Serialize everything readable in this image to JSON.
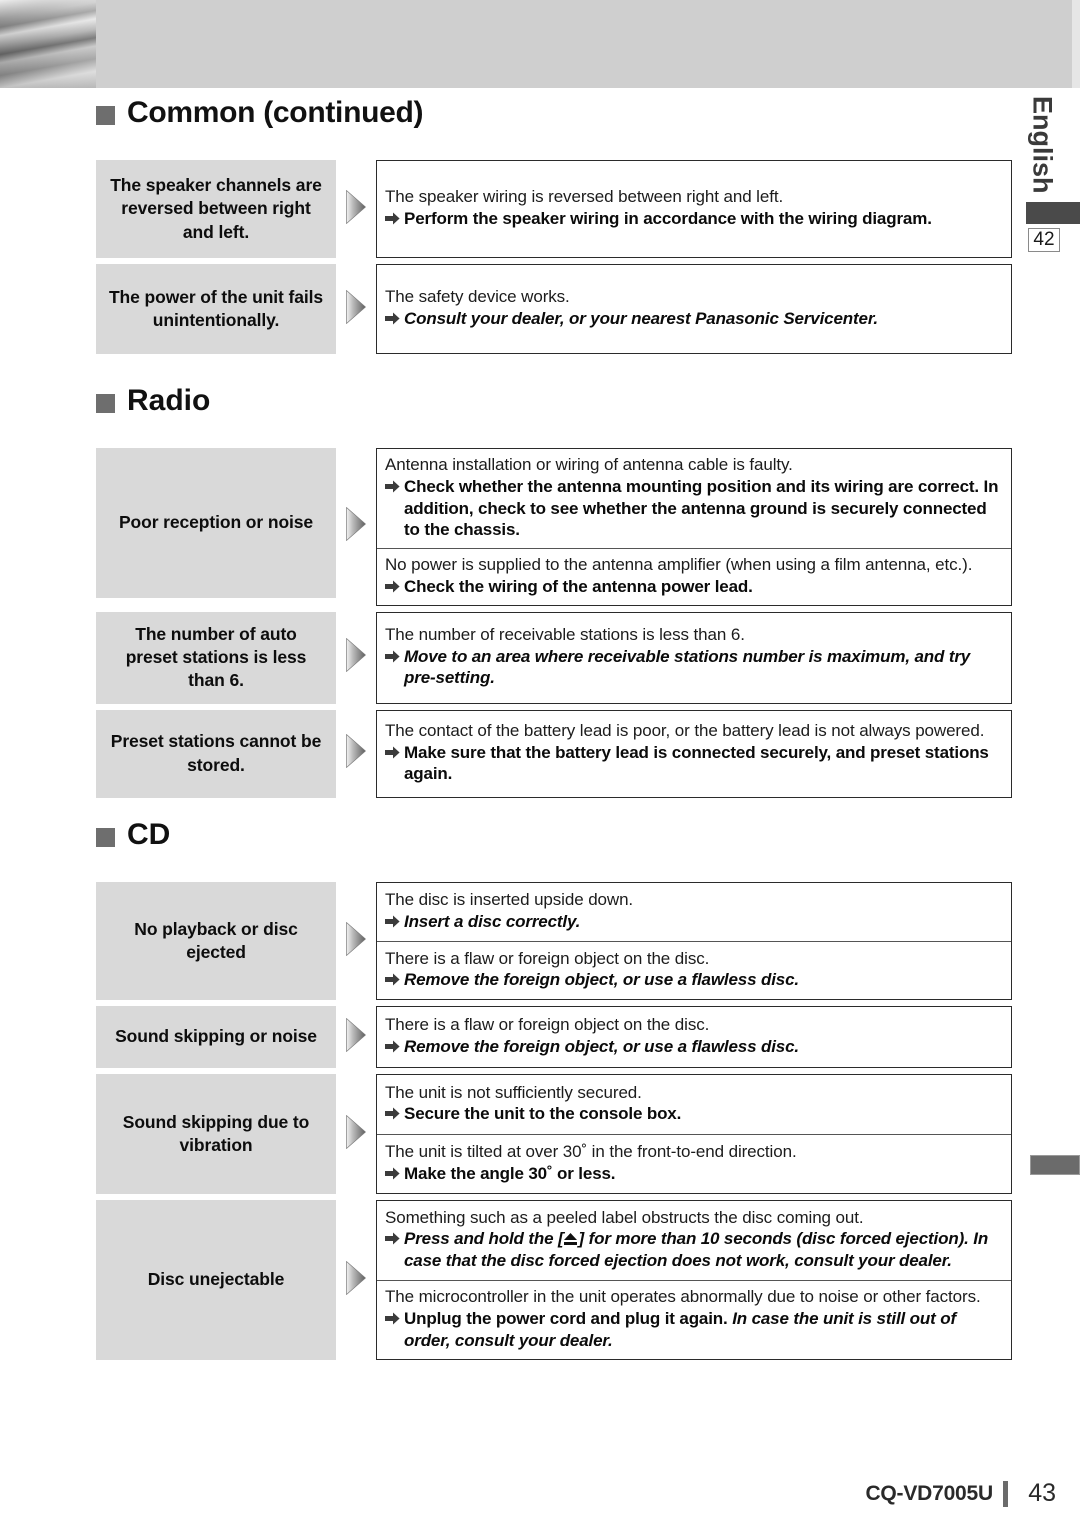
{
  "side_tab": {
    "language_label": "English",
    "page_reference": "42"
  },
  "footer": {
    "model": "CQ-VD7005U",
    "page_number": "43"
  },
  "sections": [
    {
      "heading": "Common (continued)",
      "rows": [
        {
          "symptom": "The speaker channels are reversed between right and left.",
          "label_height": 98,
          "answers": [
            {
              "cause": "The speaker wiring is reversed between right and left.",
              "fix": "Perform the speaker wiring in accordance with the wiring diagram.",
              "fix_style": "bold"
            }
          ]
        },
        {
          "symptom": "The power of the unit fails unintentionally.",
          "label_height": 90,
          "answers": [
            {
              "cause": "The safety device works.",
              "fix": "Consult your dealer, or your nearest Panasonic Servicenter.",
              "fix_style": "bold-italic"
            }
          ]
        }
      ]
    },
    {
      "heading": "Radio",
      "rows": [
        {
          "symptom": "Poor reception or noise",
          "label_height": 150,
          "answers": [
            {
              "cause": "Antenna installation or wiring of antenna cable is faulty.",
              "fix": "Check whether the antenna mounting position and its wiring are correct. In addition, check to see whether the antenna ground is securely connected to the chassis.",
              "fix_style": "bold"
            },
            {
              "cause": "No power is supplied to the antenna amplifier (when using a film antenna, etc.).",
              "fix": "Check the wiring of the antenna power lead.",
              "fix_style": "bold"
            }
          ]
        },
        {
          "symptom": "The number of auto preset stations is less than 6.",
          "label_height": 92,
          "answers": [
            {
              "cause": "The number of receivable stations is less than 6.",
              "fix": "Move to an area where receivable stations number is maximum, and try pre-setting.",
              "fix_style": "bold-italic"
            }
          ]
        },
        {
          "symptom": "Preset stations cannot be stored.",
          "label_height": 88,
          "answers": [
            {
              "cause": "The contact of the battery lead is poor, or the battery lead is not always powered.",
              "fix": "Make sure that the battery lead is connected securely, and preset stations again.",
              "fix_style": "bold"
            }
          ]
        }
      ]
    },
    {
      "heading": "CD",
      "rows": [
        {
          "symptom": "No playback or disc ejected",
          "label_height": 118,
          "answers": [
            {
              "cause": "The disc is inserted upside down.",
              "fix": "Insert a disc correctly.",
              "fix_style": "bold-italic"
            },
            {
              "cause": "There is a flaw or foreign object on the disc.",
              "fix": "Remove the foreign object, or use a flawless disc.",
              "fix_style": "bold-italic"
            }
          ]
        },
        {
          "symptom": "Sound skipping or noise",
          "label_height": 62,
          "answers": [
            {
              "cause": "There is a flaw or foreign object on the disc.",
              "fix": "Remove the foreign object, or use a flawless disc.",
              "fix_style": "bold-italic"
            }
          ]
        },
        {
          "symptom": "Sound skipping due to vibration",
          "label_height": 120,
          "answers": [
            {
              "cause": "The unit is not sufficiently secured.",
              "fix": "Secure the unit to the console box.",
              "fix_style": "bold"
            },
            {
              "cause": "The unit is tilted at over 30˚ in the front-to-end direction.",
              "fix": "Make the angle 30˚ or less.",
              "fix_style": "bold"
            }
          ]
        },
        {
          "symptom": "Disc unejectable",
          "label_height": 160,
          "answers": [
            {
              "cause": "Something such as a peeled label obstructs the disc coming out.",
              "fix": "Press and hold the [⏏] for more than 10 seconds (disc forced ejection). In case that the disc forced ejection does not work, consult your dealer.",
              "fix_style": "bold-italic",
              "has_eject_icon": true
            },
            {
              "cause": "The microcontroller in the unit operates abnormally due to noise or other factors.",
              "fix_lead": "Unplug the power cord and plug it again.",
              "fix_tail": "In case the unit is still out of order, consult your dealer.",
              "fix_style": "mixed"
            }
          ]
        }
      ]
    }
  ],
  "colors": {
    "label_bg": "#d9d9d9",
    "head_square": "#6e6e6e",
    "side_bar": "#4a4a4a",
    "border": "#2b2b2b"
  }
}
